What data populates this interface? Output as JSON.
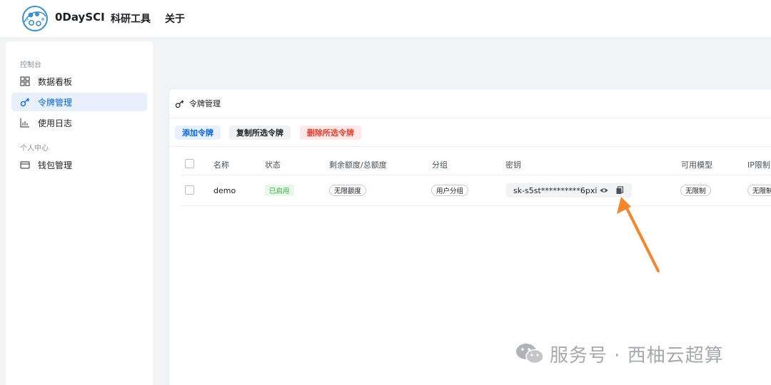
{
  "header": {
    "brand": "0DaySCI",
    "nav": [
      "科研工具",
      "关于"
    ]
  },
  "sidebar": {
    "groups": [
      {
        "label": "控制台",
        "items": [
          {
            "label": "数据看板",
            "icon": "grid-icon"
          },
          {
            "label": "令牌管理",
            "icon": "key-icon",
            "active": true
          },
          {
            "label": "使用日志",
            "icon": "bar-chart-icon"
          }
        ]
      },
      {
        "label": "个人中心",
        "items": [
          {
            "label": "钱包管理",
            "icon": "wallet-icon"
          }
        ]
      }
    ]
  },
  "main": {
    "title": "令牌管理",
    "actions": {
      "add": "添加令牌",
      "copy_selected": "复制所选令牌",
      "delete_selected": "删除所选令牌"
    },
    "table": {
      "columns": [
        "名称",
        "状态",
        "剩余额度/总额度",
        "分组",
        "密钥",
        "可用模型",
        "IP限制"
      ],
      "rows": [
        {
          "name": "demo",
          "status": "已启用",
          "quota": "无限额度",
          "group": "用户分组",
          "key": "sk-s5st**********6pxi",
          "models": "无限制",
          "ip": "无限制"
        }
      ]
    }
  },
  "watermark": {
    "text": "服务号 · 西柚云超算"
  },
  "colors": {
    "accent": "#0064fa",
    "danger": "#f23c2b",
    "success": "#3bb346",
    "arrow": "#f5862a"
  }
}
